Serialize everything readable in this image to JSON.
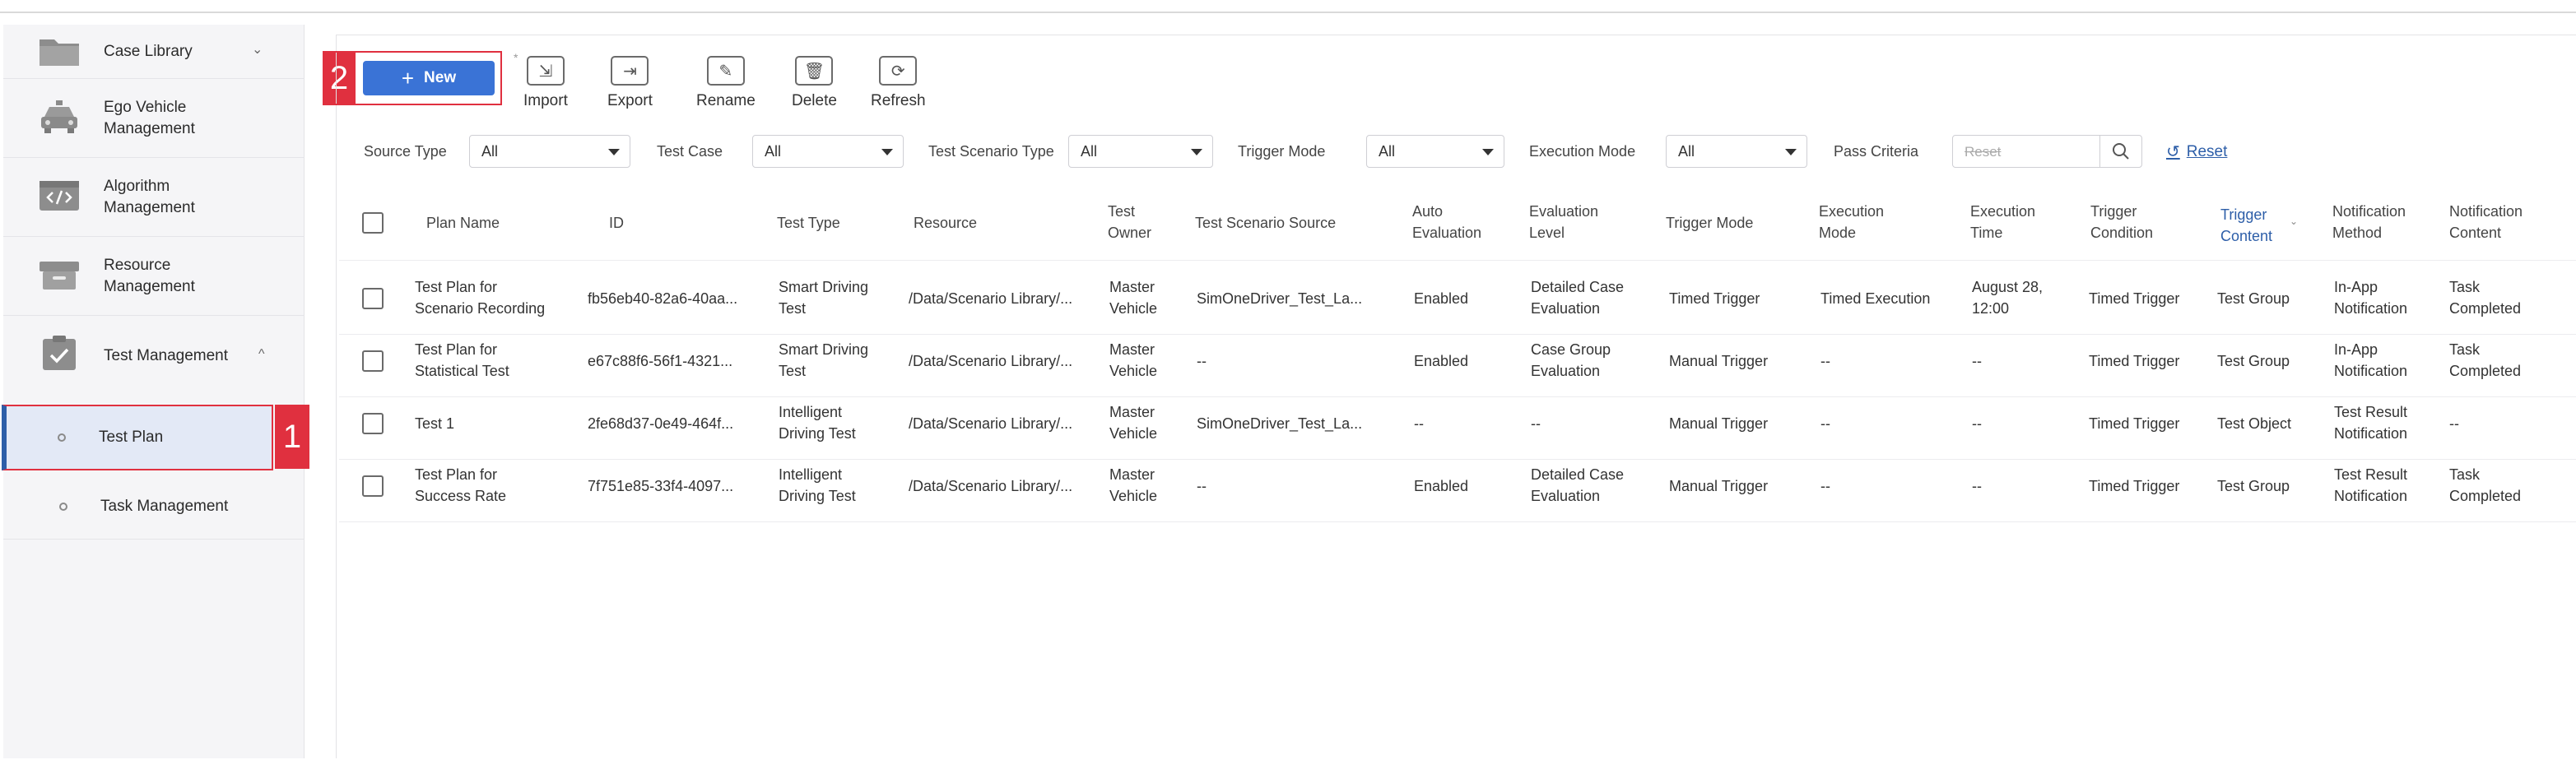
{
  "sidebar": {
    "items": [
      {
        "label": "Case Library",
        "icon": "folder-icon",
        "chevron": "⌄"
      },
      {
        "label": "Ego Vehicle\nManagement",
        "icon": "car-icon"
      },
      {
        "label": "Algorithm\nManagement",
        "icon": "code-icon"
      },
      {
        "label": "Resource\nManagement",
        "icon": "box-icon"
      },
      {
        "label": "Test Management",
        "icon": "clipboard-check-icon",
        "chevron": "^"
      }
    ],
    "subitems": [
      {
        "label": "Test Plan"
      },
      {
        "label": "Task Management"
      }
    ]
  },
  "markers": {
    "one": "1",
    "two": "2"
  },
  "toolbar": {
    "new_label": "New",
    "new_plus": "+",
    "asterisk": "*",
    "import_label": "Import",
    "export_label": "Export",
    "rename_label": "Rename",
    "delete_label": "Delete",
    "refresh_label": "Refresh"
  },
  "filters": {
    "source_type_label": "Source Type",
    "source_type_value": "All",
    "test_case_label": "Test Case",
    "test_case_value": "All",
    "test_scenario_type_label": "Test Scenario Type",
    "test_scenario_type_value": "All",
    "trigger_mode_label": "Trigger Mode",
    "trigger_mode_value": "All",
    "execution_mode_label": "Execution Mode",
    "execution_mode_value": "All",
    "pass_criteria_label": "Pass Criteria",
    "search_placeholder": "Reset",
    "reset_label": "Reset"
  },
  "table": {
    "headers": {
      "plan_name": "Plan Name",
      "id": "ID",
      "test_type": "Test Type",
      "resource": "Resource",
      "test_owner": "Test\nOwner",
      "scenario_source": "Test Scenario Source",
      "auto_eval": "Auto\nEvaluation",
      "eval_level": "Evaluation\nLevel",
      "trigger_mode": "Trigger Mode",
      "execution_mode": "Execution\nMode",
      "execution_time": "Execution\nTime",
      "trigger_condition": "Trigger\nCondition",
      "trigger_content": "Trigger\nContent",
      "notification_method": "Notification\nMethod",
      "notification_content": "Notification\nContent"
    },
    "rows": [
      {
        "plan_name": "Test Plan for\nScenario Recording",
        "id": "fb56eb40-82a6-40aa...",
        "test_type": "Smart Driving\nTest",
        "resource": "/Data/Scenario Library/...",
        "test_owner": "Master\nVehicle",
        "scenario_source": "SimOneDriver_Test_La...",
        "auto_eval": "Enabled",
        "eval_level": "Detailed Case\nEvaluation",
        "trigger_mode": "Timed Trigger",
        "execution_mode": "Timed Execution",
        "execution_time": "August 28,\n12:00",
        "trigger_condition": "Timed Trigger",
        "trigger_content": "Test Group",
        "notification_method": "In-App\nNotification",
        "notification_content": "Task\nCompleted"
      },
      {
        "plan_name": "Test Plan for\nStatistical Test",
        "id": "e67c88f6-56f1-4321...",
        "test_type": "Smart Driving\nTest",
        "resource": "/Data/Scenario Library/...",
        "test_owner": "Master\nVehicle",
        "scenario_source": "--",
        "auto_eval": "Enabled",
        "eval_level": "Case Group\nEvaluation",
        "trigger_mode": "Manual Trigger",
        "execution_mode": "--",
        "execution_time": "--",
        "trigger_condition": "Timed Trigger",
        "trigger_content": "Test Group",
        "notification_method": "In-App\nNotification",
        "notification_content": "Task\nCompleted"
      },
      {
        "plan_name": "Test 1",
        "id": "2fe68d37-0e49-464f...",
        "test_type": "Intelligent\nDriving Test",
        "resource": "/Data/Scenario Library/...",
        "test_owner": "Master\nVehicle",
        "scenario_source": "SimOneDriver_Test_La...",
        "auto_eval": "--",
        "eval_level": "--",
        "trigger_mode": "Manual Trigger",
        "execution_mode": "--",
        "execution_time": "--",
        "trigger_condition": "Timed Trigger",
        "trigger_content": "Test Object",
        "notification_method": "Test Result\nNotification",
        "notification_content": "--"
      },
      {
        "plan_name": "Test Plan for\nSuccess Rate",
        "id": "7f751e85-33f4-4097...",
        "test_type": "Intelligent\nDriving Test",
        "resource": "/Data/Scenario Library/...",
        "test_owner": "Master\nVehicle",
        "scenario_source": "--",
        "auto_eval": "Enabled",
        "eval_level": "Detailed Case\nEvaluation",
        "trigger_mode": "Manual Trigger",
        "execution_mode": "--",
        "execution_time": "--",
        "trigger_condition": "Timed Trigger",
        "trigger_content": "Test Group",
        "notification_method": "Test Result\nNotification",
        "notification_content": "Task\nCompleted"
      }
    ]
  },
  "colors": {
    "accent": "#3a73d6",
    "highlight_red": "#e0303f",
    "link_blue": "#2d5ea8"
  }
}
